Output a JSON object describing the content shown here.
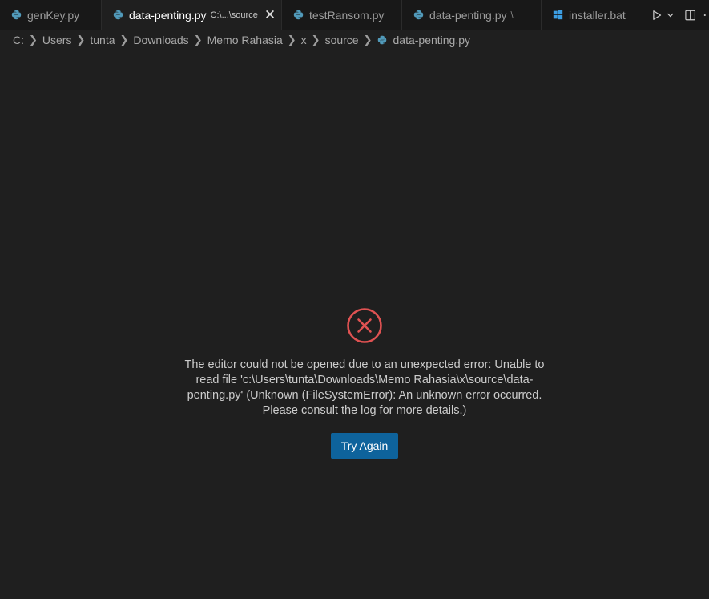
{
  "tabs": [
    {
      "label": "genKey.py",
      "description": "",
      "icon": "python-icon",
      "active": false
    },
    {
      "label": "data-penting.py",
      "description": "C:\\...\\source",
      "icon": "python-icon",
      "active": true
    },
    {
      "label": "testRansom.py",
      "description": "",
      "icon": "python-icon",
      "active": false
    },
    {
      "label": "data-penting.py",
      "description": "\\",
      "icon": "python-icon",
      "active": false
    },
    {
      "label": "installer.bat",
      "description": "",
      "icon": "windows-icon",
      "active": false
    }
  ],
  "tab_actions": {
    "run": "run-icon",
    "run_menu": "chevron-down-icon",
    "split": "split-editor-icon",
    "more": "more-icon"
  },
  "breadcrumb": [
    "C:",
    "Users",
    "tunta",
    "Downloads",
    "Memo Rahasia",
    "x",
    "source",
    "data-penting.py"
  ],
  "error": {
    "icon": "error-circle-icon",
    "message": "The editor could not be opened due to an unexpected error: Unable to read file 'c:\\Users\\tunta\\Downloads\\Memo Rahasia\\x\\source\\data-penting.py' (Unknown (FileSystemError): An unknown error occurred. Please consult the log for more details.)",
    "button_label": "Try Again"
  },
  "colors": {
    "background": "#1f1f1f",
    "tabbar": "#181818",
    "python_icon": "#519aba",
    "windows_icon": "#3c9ee3",
    "error_red": "#e05252",
    "button": "#0e639c"
  }
}
